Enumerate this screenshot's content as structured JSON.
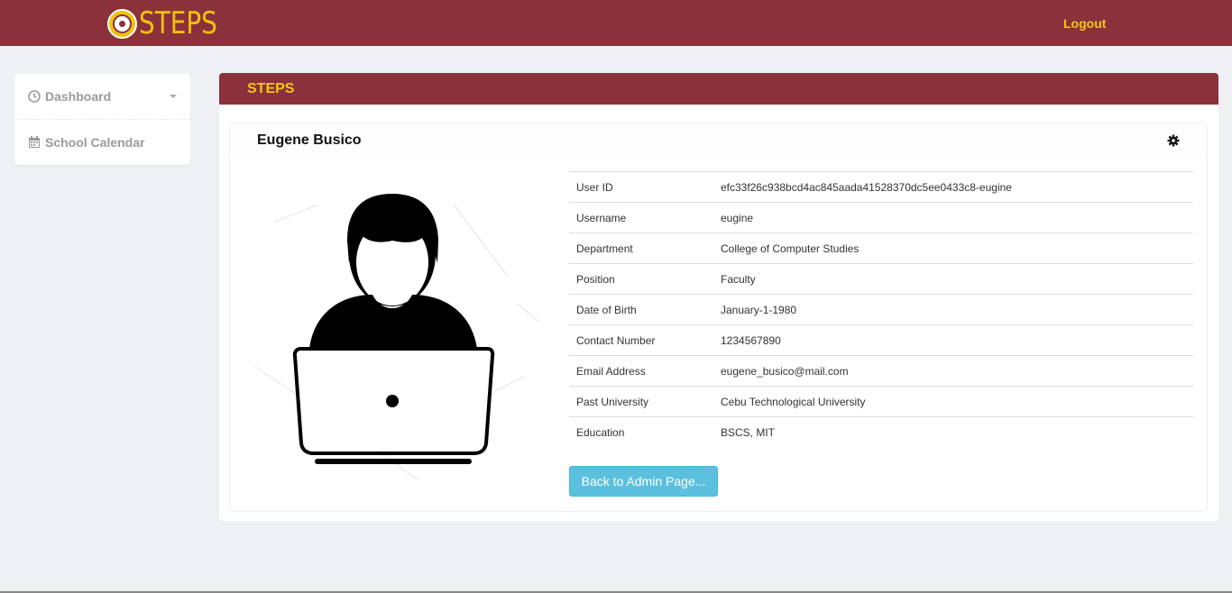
{
  "navbar": {
    "brand": "STEPS",
    "logout": "Logout"
  },
  "sidebar": {
    "items": [
      {
        "label": "Dashboard",
        "icon": "clock-icon",
        "has_dropdown": true
      },
      {
        "label": "School Calendar",
        "icon": "calendar-icon",
        "has_dropdown": false
      }
    ]
  },
  "panel": {
    "title": "STEPS"
  },
  "profile": {
    "name": "Eugene Busico",
    "fields": [
      {
        "key": "User ID",
        "value": "efc33f26c938bcd4ac845aada41528370dc5ee0433c8-eugine"
      },
      {
        "key": "Username",
        "value": "eugine"
      },
      {
        "key": "Department",
        "value": "College of Computer Studies"
      },
      {
        "key": "Position",
        "value": "Faculty"
      },
      {
        "key": "Date of Birth",
        "value": "January-1-1980"
      },
      {
        "key": "Contact Number",
        "value": "1234567890"
      },
      {
        "key": "Email Address",
        "value": "eugene_busico@mail.com"
      },
      {
        "key": "Past University",
        "value": "Cebu Technological University"
      },
      {
        "key": "Education",
        "value": "BSCS, MIT"
      }
    ],
    "back_button": "Back to Admin Page..."
  },
  "colors": {
    "brand": "#8b313c",
    "accent": "#f5c518",
    "info_button": "#5bc0de"
  }
}
